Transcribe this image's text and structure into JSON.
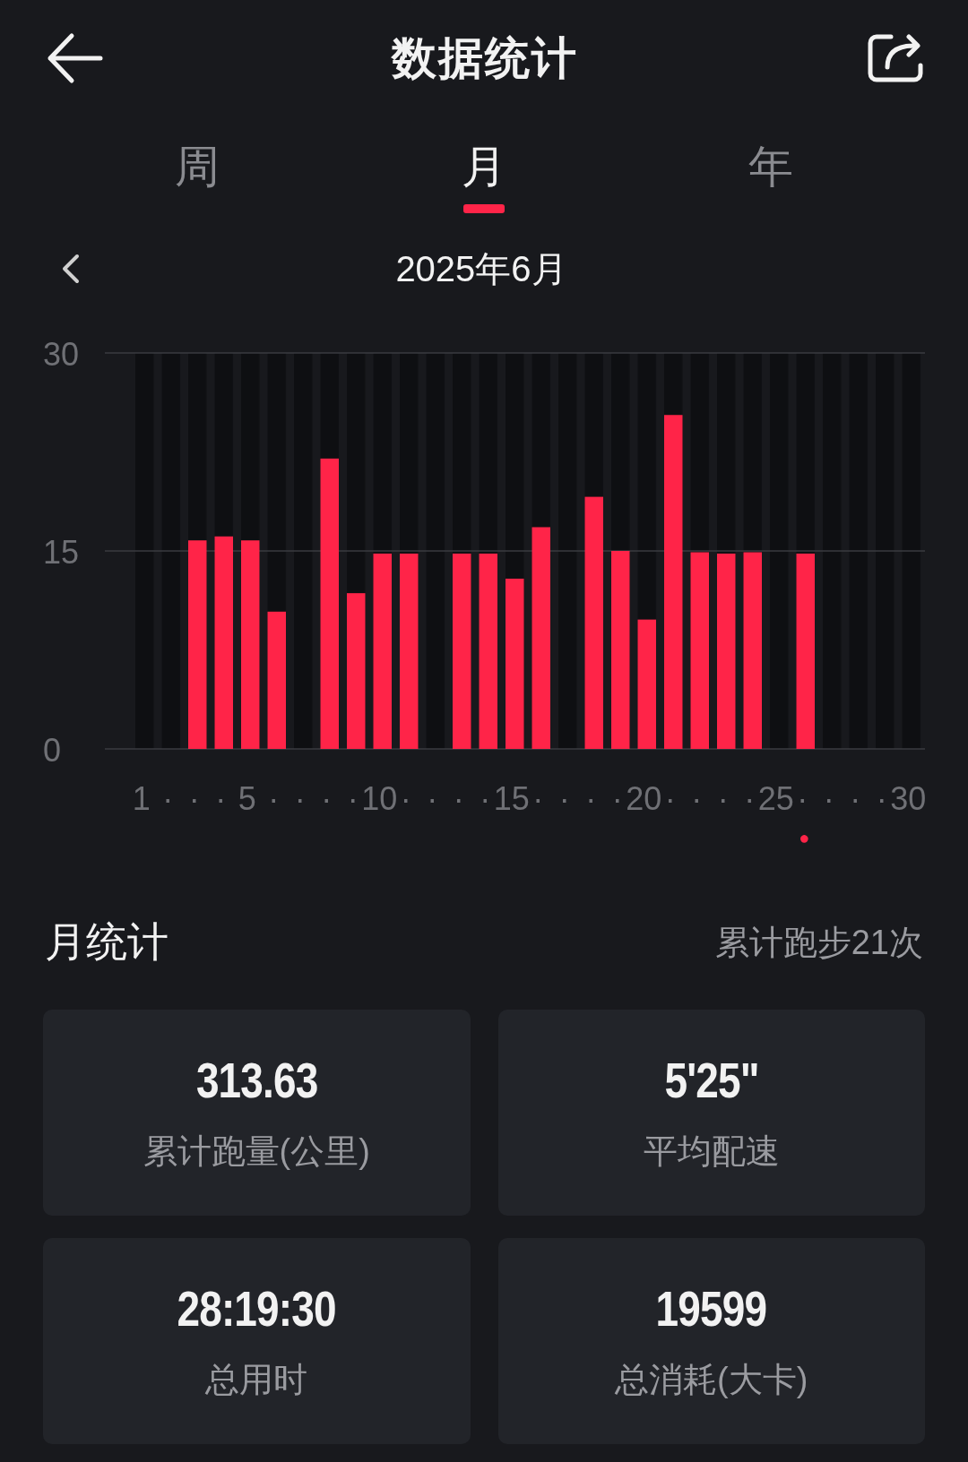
{
  "header": {
    "title": "数据统计"
  },
  "tabs": [
    {
      "label": "周",
      "selected": false
    },
    {
      "label": "月",
      "selected": true
    },
    {
      "label": "年",
      "selected": false
    }
  ],
  "period": {
    "label": "2025年6月"
  },
  "chart_data": {
    "type": "bar",
    "categories": [
      "1",
      "·",
      "·",
      "·",
      "5",
      "·",
      "·",
      "·",
      "·",
      "10",
      "·",
      "·",
      "·",
      "·",
      "15",
      "·",
      "·",
      "·",
      "·",
      "20",
      "·",
      "·",
      "·",
      "·",
      "25",
      "·",
      "·",
      "·",
      "·",
      "30"
    ],
    "values": [
      null,
      null,
      15.8,
      16.1,
      15.8,
      10.4,
      null,
      22.0,
      11.8,
      14.8,
      14.8,
      null,
      14.8,
      14.8,
      12.9,
      16.8,
      null,
      19.1,
      15.0,
      9.8,
      25.3,
      14.9,
      14.8,
      14.9,
      null,
      14.8,
      null,
      null,
      null,
      null
    ],
    "ylim": [
      0,
      30
    ],
    "yticks": [
      0,
      15,
      30
    ],
    "annotations": [
      "●"
    ]
  },
  "summary": {
    "title": "月统计",
    "count": "累计跑步21次"
  },
  "stats": [
    {
      "value": "313.63",
      "label": "累计跑量(公里)"
    },
    {
      "value": "5'25\"",
      "label": "平均配速"
    },
    {
      "value": "28:19:30",
      "label": "总用时"
    },
    {
      "value": "19599",
      "label": "总消耗(大卡)"
    }
  ]
}
